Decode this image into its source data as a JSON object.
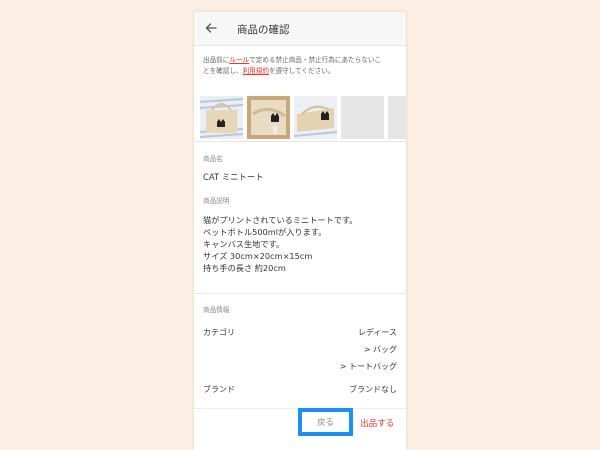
{
  "header": {
    "title": "商品の確認",
    "back_icon": "arrow-left-icon"
  },
  "notice": {
    "part1": "出品前に",
    "rule_link": "ルール",
    "part2": "で定める禁止商品・禁止行為にあたらないこ",
    "part3": "とを確認し、",
    "terms_link": "利用規約",
    "part4": "を遵守してください。"
  },
  "photos": [
    {
      "name": "tote-photo-1"
    },
    {
      "name": "tote-photo-2"
    },
    {
      "name": "tote-photo-3"
    },
    {
      "name": "empty-photo-slot"
    },
    {
      "name": "empty-photo-slot"
    }
  ],
  "product": {
    "name_label": "商品名",
    "name": "CAT ミニトート",
    "desc_label": "商品説明",
    "desc_lines": [
      "猫がプリントされているミニトートです。",
      "ペットボトル500mlが入ります。",
      "キャンバス生地です。",
      "サイズ  30cm×20cm×15cm",
      "持ち手の長さ  約20cm"
    ]
  },
  "info": {
    "label": "商品情報",
    "category_label": "カテゴリ",
    "category_values": [
      "レディース",
      "> バッグ",
      "> トートバッグ"
    ],
    "brand_label": "ブランド",
    "brand_value": "ブランドなし"
  },
  "footer": {
    "back_label": "戻る",
    "submit_label": "出品する"
  },
  "colors": {
    "accent_red": "#e8382f",
    "highlight_blue": "#1e8ef7",
    "background": "#fdeee4"
  }
}
